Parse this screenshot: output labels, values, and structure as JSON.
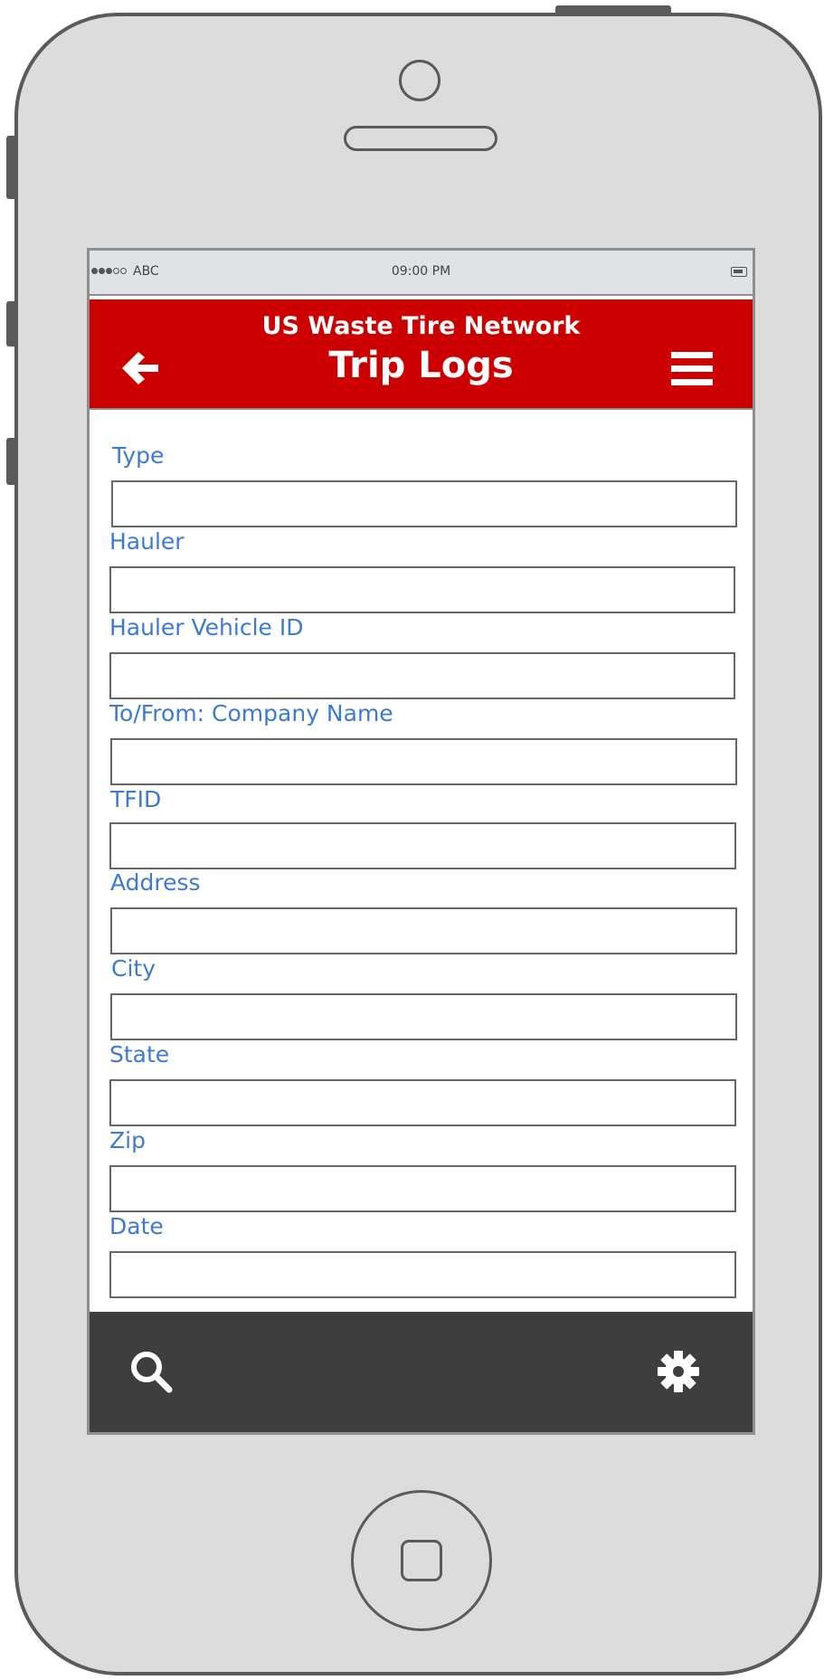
{
  "statusbar": {
    "carrier": "ABC",
    "time": "09:00 PM"
  },
  "header": {
    "subtitle": "US Waste Tire Network",
    "title": "Trip Logs",
    "back_icon": "arrow-left-icon",
    "menu_icon": "hamburger-menu-icon"
  },
  "form": {
    "fields": [
      {
        "label": "Type",
        "value": "",
        "placeholder": ""
      },
      {
        "label": "Hauler",
        "value": "",
        "placeholder": ""
      },
      {
        "label": "Hauler Vehicle ID",
        "value": "",
        "placeholder": ""
      },
      {
        "label": "To/From: Company Name",
        "value": "",
        "placeholder": ""
      },
      {
        "label": "TFID",
        "value": "",
        "placeholder": ""
      },
      {
        "label": "Address",
        "value": "",
        "placeholder": ""
      },
      {
        "label": "City",
        "value": "",
        "placeholder": ""
      },
      {
        "label": "State",
        "value": "",
        "placeholder": ""
      },
      {
        "label": "Zip",
        "value": "",
        "placeholder": ""
      },
      {
        "label": "Date",
        "value": "",
        "placeholder": ""
      }
    ]
  },
  "tabbar": {
    "search_icon": "search-icon",
    "settings_icon": "gear-icon"
  },
  "colors": {
    "header_bg": "#cc0000",
    "label": "#3d7ad2",
    "tabbar_bg": "#3e3e3e",
    "phone_body": "#dcdcdc"
  }
}
